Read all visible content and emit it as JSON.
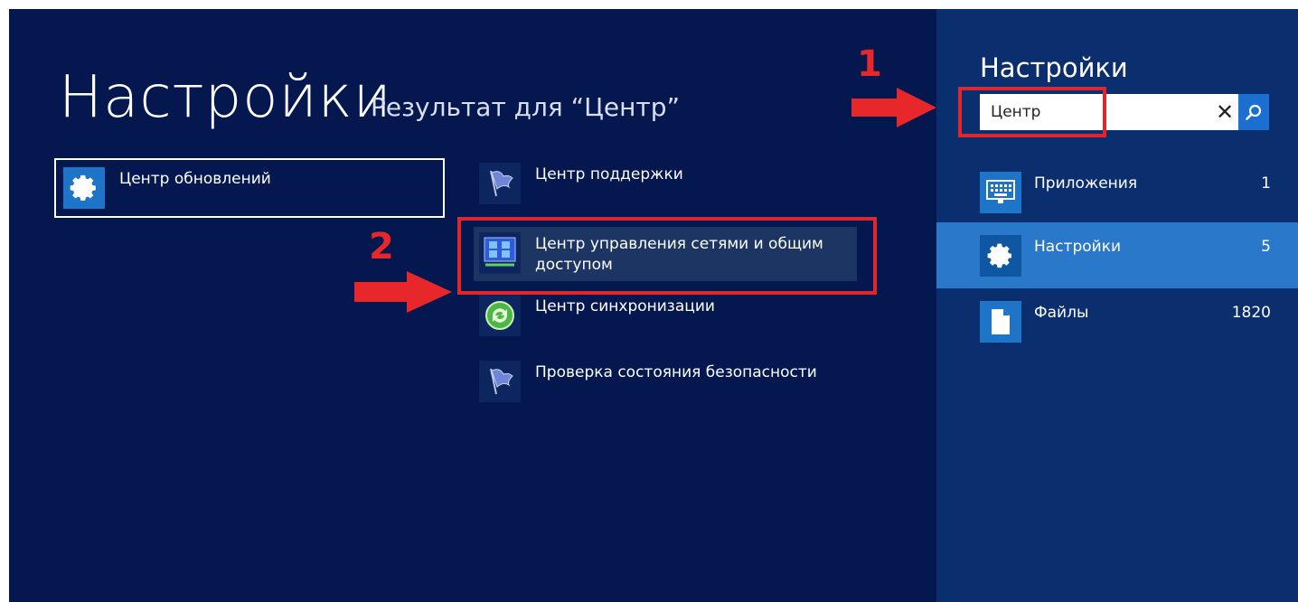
{
  "header": {
    "title": "Настройки",
    "subtitle": "Результат для “Центр”"
  },
  "results": [
    {
      "label": "Центр обновлений",
      "icon": "gear-icon"
    },
    {
      "label": "Центр поддержки",
      "icon": "flag-icon"
    },
    {
      "label": "Центр управления сетями и общим доступом",
      "icon": "network-icon"
    },
    {
      "label": "Центр синхронизации",
      "icon": "sync-icon"
    },
    {
      "label": "Проверка состояния безопасности",
      "icon": "flag-icon"
    }
  ],
  "annotations": {
    "marker1": "1",
    "marker2": "2",
    "color": "#e0262b"
  },
  "search_pane": {
    "title": "Настройки",
    "query": "Центр",
    "categories": [
      {
        "name": "Приложения",
        "count": "1",
        "icon": "keyboard-icon"
      },
      {
        "name": "Настройки",
        "count": "5",
        "icon": "gear-icon"
      },
      {
        "name": "Файлы",
        "count": "1820",
        "icon": "file-icon"
      }
    ]
  },
  "colors": {
    "background": "#04174f",
    "pane": "#0b2e6e",
    "accent": "#2a78c9"
  }
}
